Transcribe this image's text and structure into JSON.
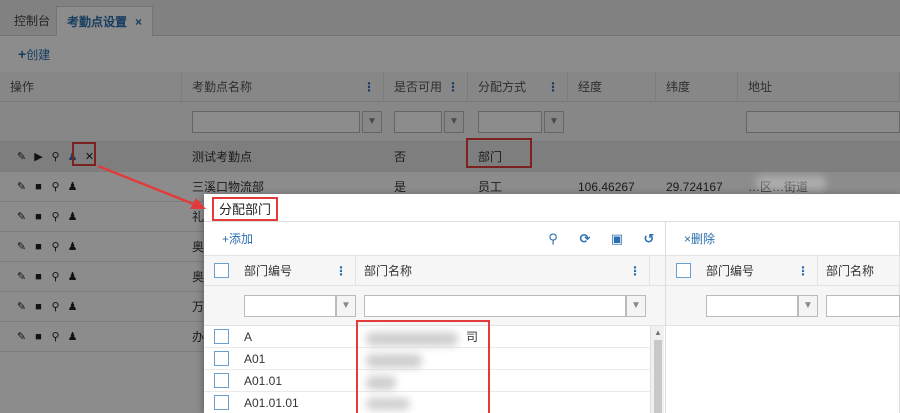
{
  "tabs": [
    {
      "label": "控制台"
    },
    {
      "label": "考勤点设置",
      "close": "×"
    }
  ],
  "toolbar": {
    "create_label": "创建",
    "create_plus": "+"
  },
  "grid": {
    "columns": [
      "操作",
      "考勤点名称",
      "是否可用",
      "分配方式",
      "经度",
      "纬度",
      "地址"
    ],
    "rows": [
      {
        "name": "测试考勤点",
        "available": "否",
        "method": "部门",
        "lng": "",
        "lat": "",
        "addr": ""
      },
      {
        "name": "三溪口物流部",
        "available": "是",
        "method": "员工",
        "lng": "106.46267",
        "lat": "29.724167",
        "addr": "…区…街道"
      },
      {
        "name": "礼",
        "available": "",
        "method": "",
        "lng": "",
        "lat": "",
        "addr": ""
      },
      {
        "name": "奥",
        "available": "",
        "method": "",
        "lng": "",
        "lat": "",
        "addr": ""
      },
      {
        "name": "奥",
        "available": "",
        "method": "",
        "lng": "",
        "lat": "",
        "addr": ""
      },
      {
        "name": "万",
        "available": "",
        "method": "",
        "lng": "",
        "lat": "",
        "addr": ""
      },
      {
        "name": "办",
        "available": "",
        "method": "",
        "lng": "",
        "lat": "",
        "addr": ""
      }
    ]
  },
  "modal": {
    "title": "分配部门",
    "left": {
      "add_label": "+添加",
      "columns": [
        "部门编号",
        "部门名称"
      ],
      "rows": [
        {
          "code": "A",
          "name": "司"
        },
        {
          "code": "A01",
          "name": ""
        },
        {
          "code": "A01.01",
          "name": ""
        },
        {
          "code": "A01.01.01",
          "name": ""
        }
      ]
    },
    "right": {
      "delete_label": "×删除",
      "columns": [
        "部门编号",
        "部门名称"
      ]
    }
  },
  "colors": {
    "accent": "#2a6fb0",
    "highlight": "#e23b3b"
  }
}
